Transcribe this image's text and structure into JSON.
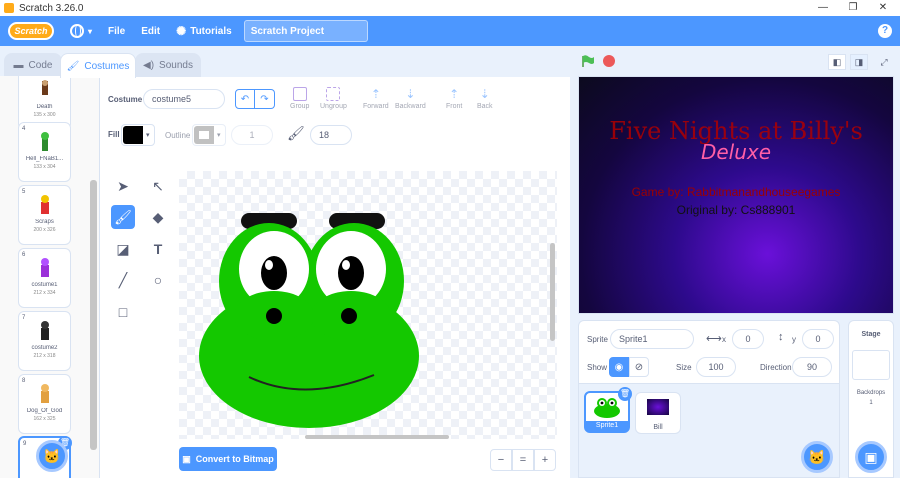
{
  "window": {
    "title": "Scratch 3.26.0"
  },
  "menubar": {
    "logo": "Scratch",
    "file": "File",
    "edit": "Edit",
    "tutorials": "Tutorials",
    "project_title": "Scratch Project",
    "help": "?"
  },
  "tabs": [
    {
      "label": "Code",
      "active": false
    },
    {
      "label": "Costumes",
      "active": true
    },
    {
      "label": "Sounds",
      "active": false
    }
  ],
  "costumes": [
    {
      "num": "",
      "name": "Death",
      "size": "135 x 300"
    },
    {
      "num": "4",
      "name": "Hell_FNaB1...",
      "size": "133 x 304"
    },
    {
      "num": "5",
      "name": "Scraps",
      "size": "200 x 326"
    },
    {
      "num": "6",
      "name": "costume1",
      "size": "212 x 334"
    },
    {
      "num": "7",
      "name": "costume2",
      "size": "212 x 318"
    },
    {
      "num": "8",
      "name": "Dog_Of_God",
      "size": "162 x 325"
    },
    {
      "num": "9",
      "name": "",
      "size": ""
    }
  ],
  "editor": {
    "costume_label": "Costume",
    "costume_name": "costume5",
    "fill_label": "Fill",
    "outline_label": "Outline",
    "outline_width": "1",
    "brush_size": "18",
    "group": "Group",
    "ungroup": "Ungroup",
    "forward": "Forward",
    "backward": "Backward",
    "front": "Front",
    "back": "Back",
    "convert": "Convert to Bitmap",
    "zoom_out": "−",
    "zoom_reset": "=",
    "zoom_in": "+"
  },
  "stage": {
    "title": "Five Nights at Billy's",
    "subtitle": "Deluxe",
    "credit1": "Game by: Rabbitmanandhouseegames",
    "credit2": "Original by: Cs888901"
  },
  "sprite_info": {
    "sprite_label": "Sprite",
    "sprite_name": "Sprite1",
    "x_label": "x",
    "x_value": "0",
    "y_label": "y",
    "y_value": "0",
    "show_label": "Show",
    "size_label": "Size",
    "size_value": "100",
    "direction_label": "Direction",
    "direction_value": "90"
  },
  "sprites": [
    {
      "name": "Sprite1",
      "selected": true
    },
    {
      "name": "Bill",
      "selected": false
    }
  ],
  "stage_panel": {
    "label": "Stage",
    "backdrops_label": "Backdrops",
    "backdrops_count": "1"
  },
  "colors": {
    "accent": "#4c97ff",
    "frog_green": "#14c800",
    "fill_color": "#000000"
  }
}
